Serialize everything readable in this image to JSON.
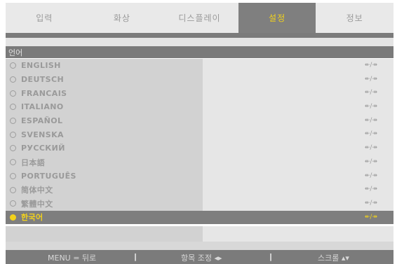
{
  "tabs": [
    "입력",
    "화상",
    "디스플레이",
    "설정",
    "정보"
  ],
  "active_tab": "설정",
  "header": {
    "title": "언어"
  },
  "languages": [
    {
      "label": "ENGLISH",
      "selected": false,
      "arrows": "↞/↠"
    },
    {
      "label": "DEUTSCH",
      "selected": false,
      "arrows": "↞/↠"
    },
    {
      "label": "FRANCAIS",
      "selected": false,
      "arrows": "↞/↠"
    },
    {
      "label": "ITALIANO",
      "selected": false,
      "arrows": "↞/↠"
    },
    {
      "label": "ESPAÑOL",
      "selected": false,
      "arrows": "↞/↠"
    },
    {
      "label": "SVENSKA",
      "selected": false,
      "arrows": "↞/↠"
    },
    {
      "label": "РУССКИЙ",
      "selected": false,
      "arrows": "↞/↠"
    },
    {
      "label": "日本語",
      "selected": false,
      "arrows": "↞/↠"
    },
    {
      "label": "PORTUGUÊS",
      "selected": false,
      "arrows": "↞/↠"
    },
    {
      "label": "简体中文",
      "selected": false,
      "arrows": "↞/↠"
    },
    {
      "label": "繁體中文",
      "selected": false,
      "arrows": "↞/↠"
    },
    {
      "label": "한국어",
      "selected": true,
      "arrows": "↞/↠"
    }
  ],
  "footer": {
    "menu": "MENU = 뒤로",
    "adjust": "항목 조정 ◂▸",
    "scroll": "스크롤 ▴▾",
    "separator": "|"
  },
  "colors": {
    "accent": "#f2d21b",
    "dark_bar": "#7b7b7b"
  }
}
